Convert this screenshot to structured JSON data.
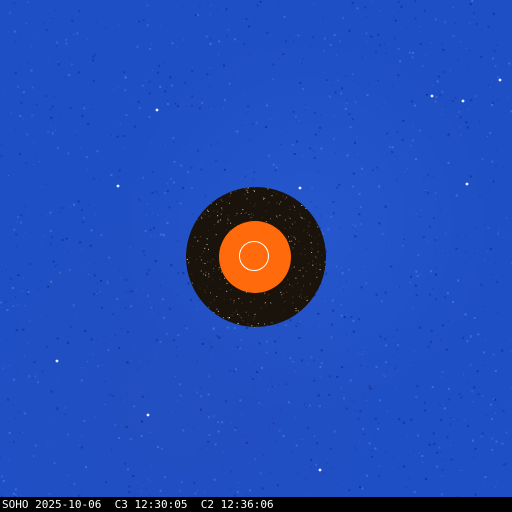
{
  "caption": {
    "observatory": "SOHO",
    "date": "2025-10-06",
    "c3_label": "C3",
    "c3_time": "12:30:05",
    "c2_label": "C2",
    "c2_time": "12:36:06"
  },
  "colors": {
    "c3_background": "#1f4fc4",
    "c2_background": "#1a130c",
    "occulter": "#ff6a0c",
    "limb_circle": "#ffffff",
    "caption_bar": "#000000",
    "caption_text": "#ffffff"
  }
}
